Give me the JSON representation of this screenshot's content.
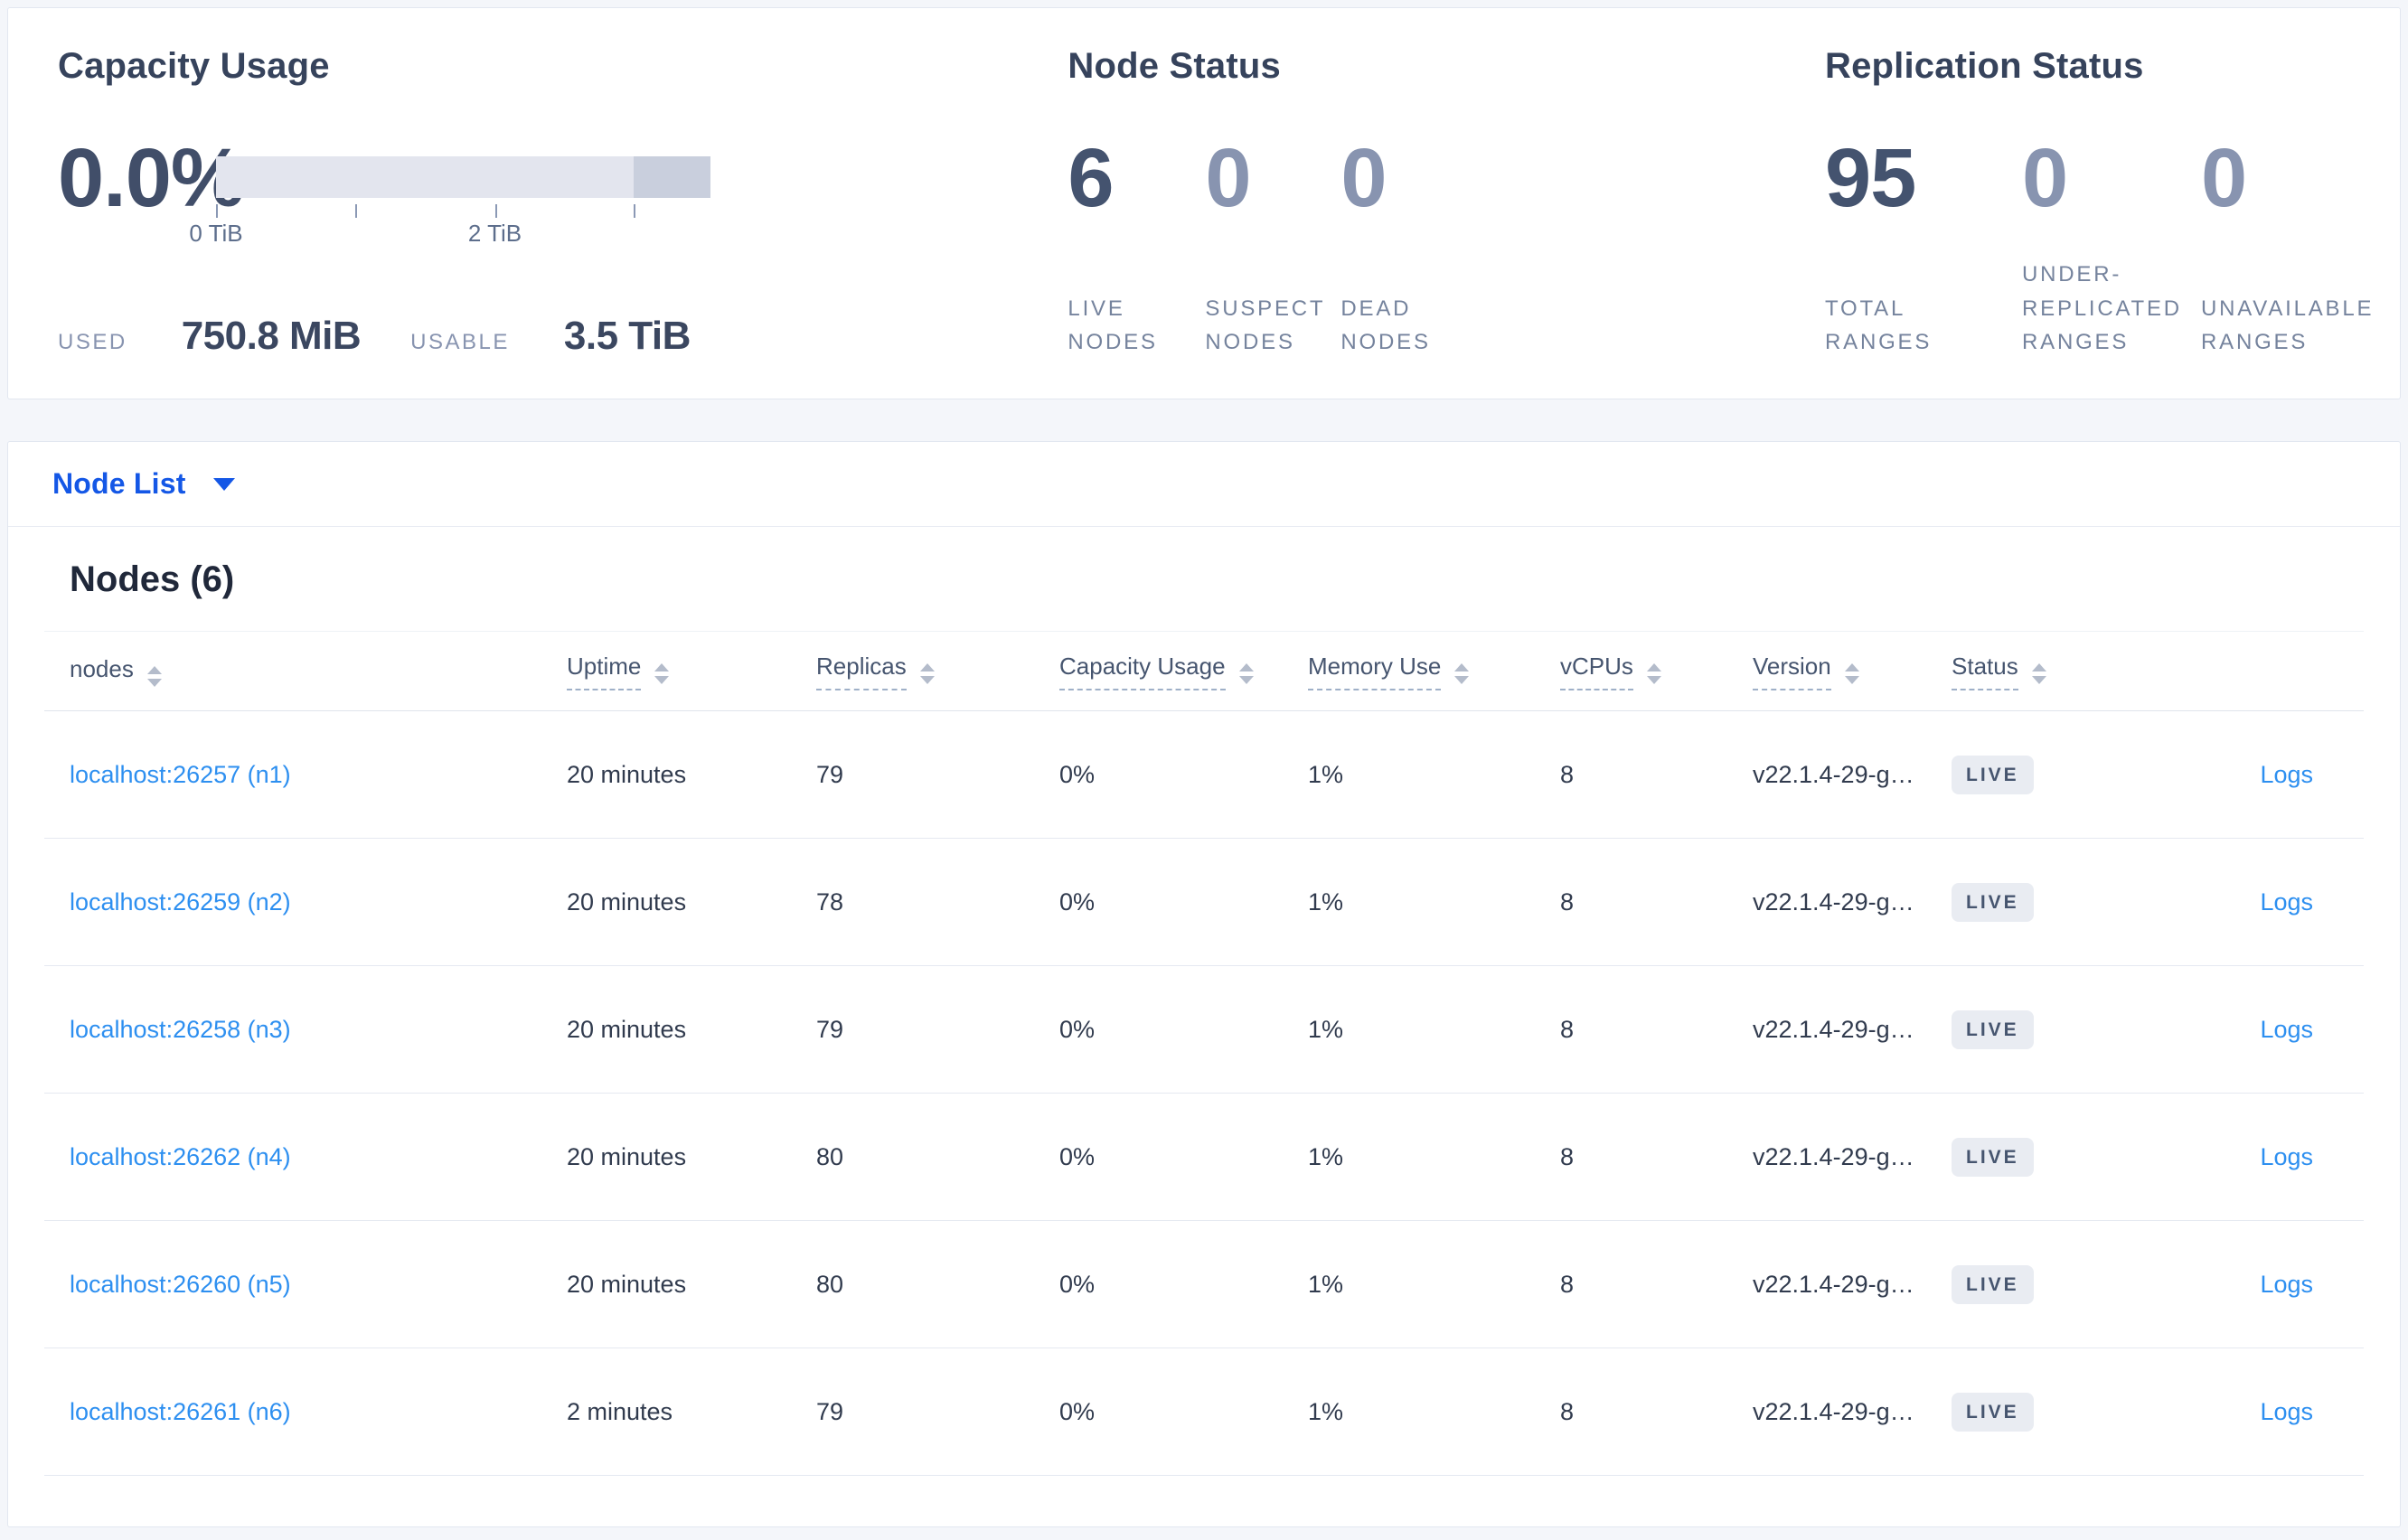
{
  "capacity_usage": {
    "title": "Capacity Usage",
    "percent": "0.0%",
    "axis_ticks": [
      "0 TiB",
      "2 TiB"
    ],
    "used_label": "USED",
    "used_value": "750.8 MiB",
    "usable_label": "USABLE",
    "usable_value": "3.5 TiB"
  },
  "node_status": {
    "title": "Node Status",
    "stats": [
      {
        "value": "6",
        "label": "LIVE\nNODES"
      },
      {
        "value": "0",
        "label": "SUSPECT\nNODES"
      },
      {
        "value": "0",
        "label": "DEAD\nNODES"
      }
    ]
  },
  "replication_status": {
    "title": "Replication Status",
    "stats": [
      {
        "value": "95",
        "label": "TOTAL\nRANGES"
      },
      {
        "value": "0",
        "label": "UNDER-\nREPLICATED\nRANGES"
      },
      {
        "value": "0",
        "label": "UNAVAILABLE\nRANGES"
      }
    ]
  },
  "node_list": {
    "label": "Node List"
  },
  "nodes_table": {
    "heading": "Nodes (6)",
    "columns": [
      {
        "label": "nodes"
      },
      {
        "label": "Uptime"
      },
      {
        "label": "Replicas"
      },
      {
        "label": "Capacity Usage"
      },
      {
        "label": "Memory Use"
      },
      {
        "label": "vCPUs"
      },
      {
        "label": "Version"
      },
      {
        "label": "Status"
      }
    ],
    "rows": [
      {
        "address": "localhost:26257 (n1)",
        "uptime": "20 minutes",
        "replicas": "79",
        "capacity_usage": "0%",
        "memory_use": "1%",
        "vcpus": "8",
        "version": "v22.1.4-29-g…",
        "status": "LIVE",
        "logs": "Logs"
      },
      {
        "address": "localhost:26259 (n2)",
        "uptime": "20 minutes",
        "replicas": "78",
        "capacity_usage": "0%",
        "memory_use": "1%",
        "vcpus": "8",
        "version": "v22.1.4-29-g…",
        "status": "LIVE",
        "logs": "Logs"
      },
      {
        "address": "localhost:26258 (n3)",
        "uptime": "20 minutes",
        "replicas": "79",
        "capacity_usage": "0%",
        "memory_use": "1%",
        "vcpus": "8",
        "version": "v22.1.4-29-g…",
        "status": "LIVE",
        "logs": "Logs"
      },
      {
        "address": "localhost:26262 (n4)",
        "uptime": "20 minutes",
        "replicas": "80",
        "capacity_usage": "0%",
        "memory_use": "1%",
        "vcpus": "8",
        "version": "v22.1.4-29-g…",
        "status": "LIVE",
        "logs": "Logs"
      },
      {
        "address": "localhost:26260 (n5)",
        "uptime": "20 minutes",
        "replicas": "80",
        "capacity_usage": "0%",
        "memory_use": "1%",
        "vcpus": "8",
        "version": "v22.1.4-29-g…",
        "status": "LIVE",
        "logs": "Logs"
      },
      {
        "address": "localhost:26261 (n6)",
        "uptime": "2 minutes",
        "replicas": "79",
        "capacity_usage": "0%",
        "memory_use": "1%",
        "vcpus": "8",
        "version": "v22.1.4-29-g…",
        "status": "LIVE",
        "logs": "Logs"
      }
    ]
  },
  "colors": {
    "accent_blue": "#1457e6",
    "link_blue": "#2d8ff0",
    "badge_bg": "#e9ecf2",
    "bar_light": "#e3e5ee",
    "bar_dark": "#c9cfdd"
  }
}
